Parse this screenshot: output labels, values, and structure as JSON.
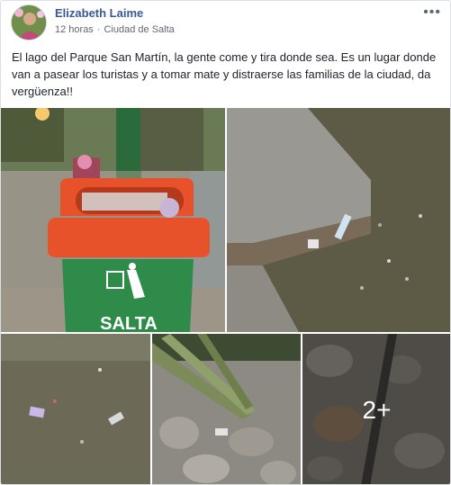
{
  "post": {
    "author": "Elizabeth Laime",
    "time": "12 horas",
    "separator": "·",
    "location": "Ciudad de Salta",
    "more_icon": "more-options-icon",
    "text": "El lago del Parque San Martín, la gente come y tira donde sea. Es un lugar donde van a pasear los turistas y a tomar mate y distraerse las familias de la ciudad, da vergüenza!!"
  },
  "photos": {
    "trash_bin_label": "SALTA",
    "more_count": "2+"
  },
  "colors": {
    "author_link": "#385898",
    "meta_text": "#616770",
    "bin_orange": "#e8522a",
    "bin_green": "#2e8b4a"
  }
}
